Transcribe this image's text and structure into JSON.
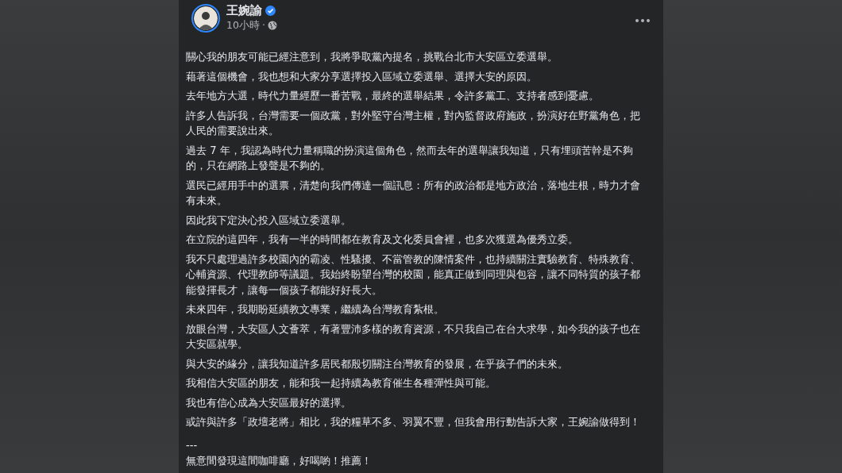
{
  "post": {
    "author": {
      "name": "王婉諭",
      "verified": true,
      "has_story": true
    },
    "time": "10小時",
    "separator": "·",
    "paragraphs": [
      "關心我的朋友可能已經注意到，我將爭取黨內提名，挑戰台北市大安區立委選舉。",
      "藉著這個機會，我也想和大家分享選擇投入區域立委選舉、選擇大安的原因。",
      "去年地方大選，時代力量經歷一番苦戰，最終的選舉結果，令許多黨工、支持者感到憂慮。",
      "許多人告訴我，台灣需要一個政黨，對外堅守台灣主權，對內監督政府施政，扮演好在野黨角色，把人民的需要說出來。",
      "過去 7 年，我認為時代力量稱職的扮演這個角色，然而去年的選舉讓我知道，只有埋頭苦幹是不夠的，只在網路上發聲是不夠的。",
      "選民已經用手中的選票，清楚向我們傳達一個訊息：所有的政治都是地方政治，落地生根，時力才會有未來。",
      "因此我下定決心投入區域立委選舉。",
      "在立院的這四年，我有一半的時間都在教育及文化委員會裡，也多次獲選為優秀立委。",
      "我不只處理過許多校園內的霸凌、性騷擾、不當管教的陳情案件，也持續關注實驗教育、特殊教育、心輔資源、代理教師等議題。我始終盼望台灣的校園，能真正做到同理與包容，讓不同特質的孩子都能發揮長才，讓每一個孩子都能好好長大。",
      "未來四年，我期盼延續教文專業，繼續為台灣教育紮根。",
      "放眼台灣，大安區人文薈萃，有著豐沛多樣的教育資源，不只我自己在台大求學，如今我的孩子也在大安區就學。",
      "與大安的緣分，讓我知道許多居民都殷切關注台灣教育的發展，在乎孩子們的未來。",
      "我相信大安區的朋友，能和我一起持續為教育催生各種彈性與可能。",
      "我也有信心成為大安區最好的選擇。",
      "或許與許多「政壇老將」相比，我的糧草不多、羽翼不豐，但我會用行動告訴大家，王婉諭做得到！"
    ],
    "footer_lines": [
      "---",
      "無意間發現這間咖啡廳，好喝喲！推薦！"
    ]
  }
}
